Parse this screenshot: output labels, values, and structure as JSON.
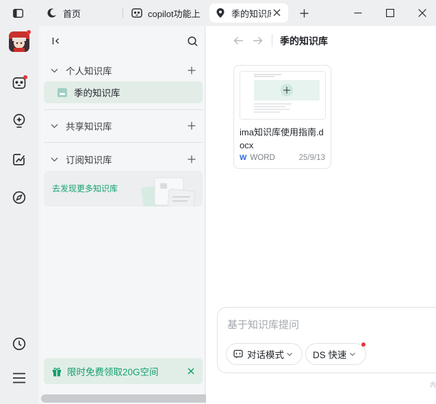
{
  "tabs": [
    {
      "label": "首页",
      "icon": "moon-icon"
    },
    {
      "label": "copilot功能上",
      "icon": "panda-icon"
    },
    {
      "label": "季的知识库",
      "icon": "location-pin-icon",
      "active": true
    }
  ],
  "sidebar": {
    "sections": {
      "personal": "个人知识库",
      "shared": "共享知识库",
      "subscribed": "订阅知识库"
    },
    "personal_item": "季的知识库",
    "discover": "去发现更多知识库",
    "promo": "限时免费领取20G空间"
  },
  "main": {
    "breadcrumb": "季的知识库",
    "file": {
      "name": "ima知识库使用指南.docx",
      "type": "WORD",
      "date": "25/9/13"
    },
    "ask": {
      "placeholder": "基于知识库提问",
      "mode_label": "对话模式",
      "model_label": "DS 快速"
    },
    "edge_text": "内"
  },
  "colors": {
    "accent": "#13a06b",
    "selected_bg": "#e3ede8",
    "notification": "#e5353b",
    "word_blue": "#2b67d8"
  }
}
